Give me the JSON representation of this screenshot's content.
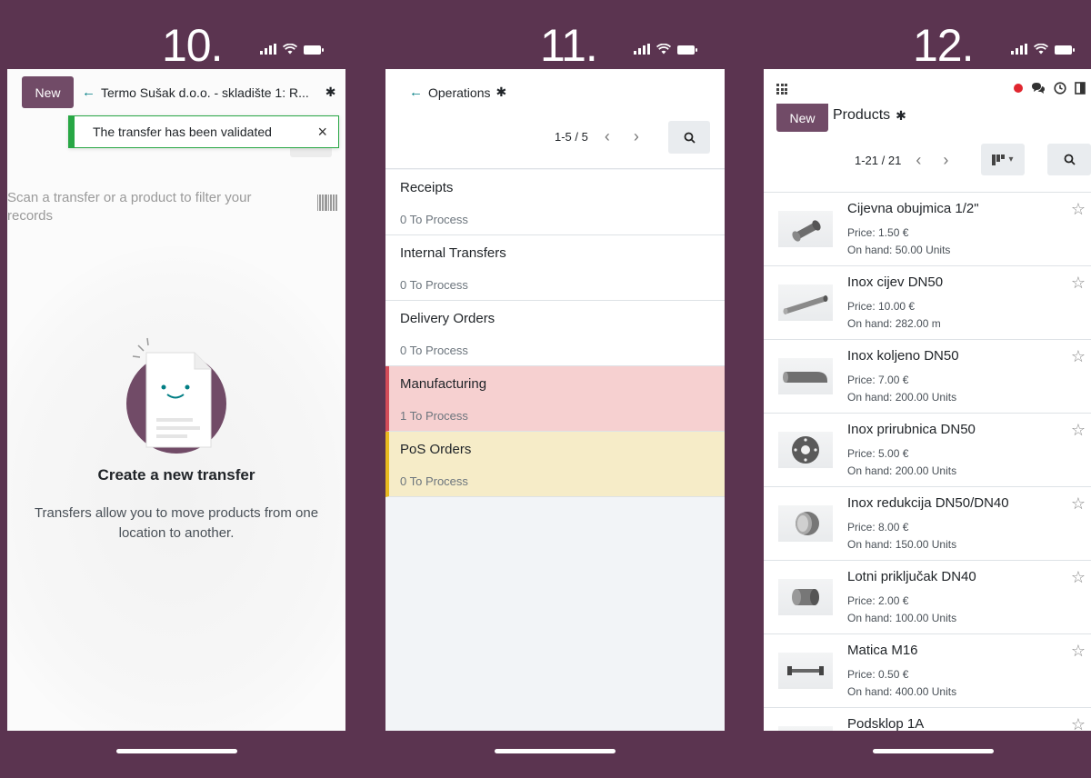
{
  "screens": {
    "s10": {
      "step": "10.",
      "new_label": "New",
      "breadcrumb": "Termo Sušak d.o.o. - skladište 1: R...",
      "toast": "The transfer has been validated",
      "toast_close": "×",
      "scan_placeholder": "Scan a transfer or a product to filter your records",
      "empty_title": "Create a new transfer",
      "empty_desc": "Transfers allow you to move products from one location to another."
    },
    "s11": {
      "step": "11.",
      "breadcrumb": "Operations",
      "pager": "1-5 / 5",
      "operations": [
        {
          "name": "Receipts",
          "count": "0 To Process",
          "state": "normal"
        },
        {
          "name": "Internal Transfers",
          "count": "0 To Process",
          "state": "normal"
        },
        {
          "name": "Delivery Orders",
          "count": "0 To Process",
          "state": "normal"
        },
        {
          "name": "Manufacturing",
          "count": "1 To Process",
          "state": "danger"
        },
        {
          "name": "PoS Orders",
          "count": "0 To Process",
          "state": "warning"
        }
      ]
    },
    "s12": {
      "step": "12.",
      "new_label": "New",
      "title": "Products",
      "pager": "1-21 / 21",
      "products": [
        {
          "name": "Cijevna obujmica 1/2\"",
          "price": "Price: 1.50 €",
          "onhand": "On hand: 50.00 Units",
          "thumb": "pipe-clamp"
        },
        {
          "name": "Inox cijev DN50",
          "price": "Price: 10.00 €",
          "onhand": "On hand: 282.00 m",
          "thumb": "pipe"
        },
        {
          "name": "Inox koljeno DN50",
          "price": "Price: 7.00 €",
          "onhand": "On hand: 200.00 Units",
          "thumb": "elbow"
        },
        {
          "name": "Inox prirubnica DN50",
          "price": "Price: 5.00 €",
          "onhand": "On hand: 200.00 Units",
          "thumb": "flange"
        },
        {
          "name": "Inox redukcija DN50/DN40",
          "price": "Price: 8.00 €",
          "onhand": "On hand: 150.00 Units",
          "thumb": "reducer"
        },
        {
          "name": "Lotni priključak DN40",
          "price": "Price: 2.00 €",
          "onhand": "On hand: 100.00 Units",
          "thumb": "connector"
        },
        {
          "name": "Matica M16",
          "price": "Price: 0.50 €",
          "onhand": "On hand: 400.00 Units",
          "thumb": "bolt"
        },
        {
          "name": "Podsklop 1A",
          "price": "",
          "onhand": "",
          "thumb": "subassembly"
        }
      ]
    }
  },
  "colors": {
    "frame": "#5b3450",
    "brand": "#714b67",
    "success": "#28a745",
    "teal": "#017e84",
    "danger_bg": "#f6d0d0",
    "danger_border": "#d44c59",
    "warning_bg": "#f6ecc8",
    "warning_border": "#e9b91f"
  }
}
